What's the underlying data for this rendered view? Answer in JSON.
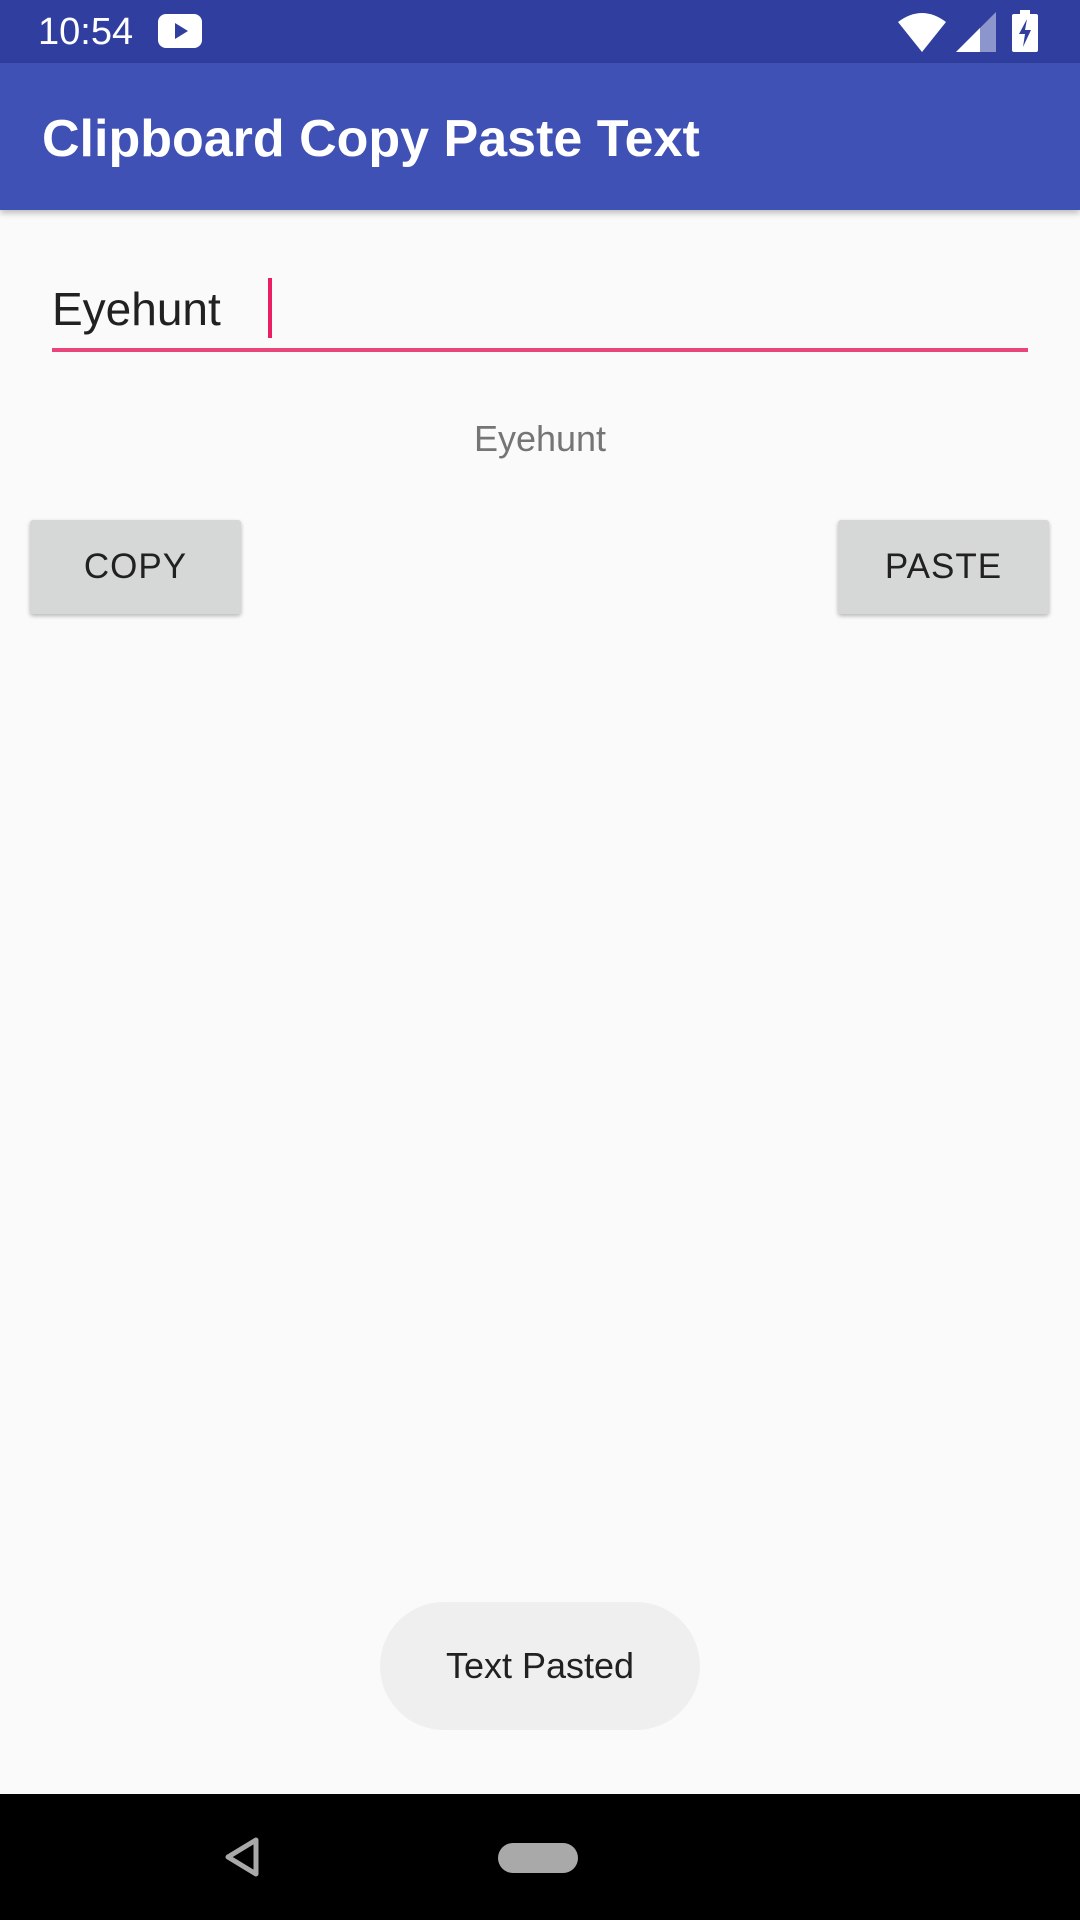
{
  "status_bar": {
    "time": "10:54",
    "icons": [
      "youtube-icon",
      "wifi-icon",
      "signal-icon",
      "battery-charging-icon"
    ],
    "color": "#303f9f"
  },
  "app_bar": {
    "title": "Clipboard Copy Paste Text",
    "color": "#3f51b5"
  },
  "edit_text": {
    "value": "Eyehunt",
    "accent_color": "#e8457a"
  },
  "result_text": "Eyehunt",
  "buttons": {
    "copy_label": "COPY",
    "paste_label": "PASTE"
  },
  "toast": {
    "message": "Text Pasted"
  },
  "nav_bar": {
    "icons": [
      "back-icon",
      "home-pill-icon"
    ]
  }
}
